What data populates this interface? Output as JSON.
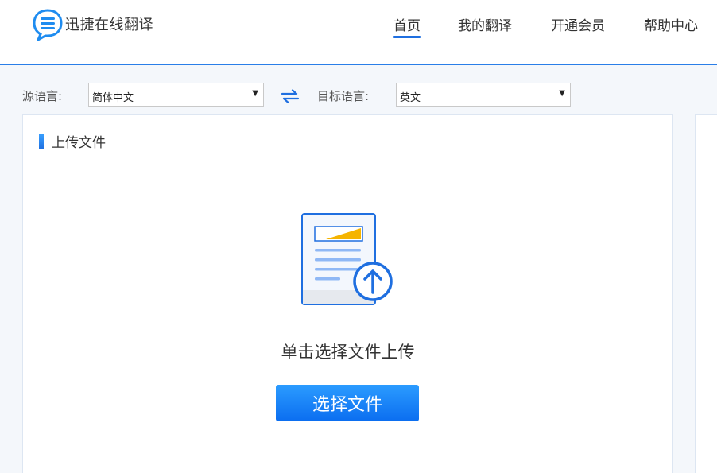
{
  "app": {
    "name": "迅捷在线翻译"
  },
  "nav": {
    "items": [
      {
        "label": "首页",
        "active": true
      },
      {
        "label": "我的翻译",
        "active": false
      },
      {
        "label": "开通会员",
        "active": false
      },
      {
        "label": "帮助中心",
        "active": false
      }
    ]
  },
  "languages": {
    "source_label": "源语言:",
    "source_value": "简体中文",
    "target_label": "目标语言:",
    "target_value": "英文",
    "swap_icon": "swap-arrows-icon"
  },
  "upload": {
    "title": "上传文件",
    "hint": "单击选择文件上传",
    "button_label": "选择文件",
    "icon": "document-upload-icon"
  },
  "colors": {
    "accent": "#1f6fe0",
    "button": "#0b6ef0",
    "doc_highlight": "#f5b400"
  }
}
